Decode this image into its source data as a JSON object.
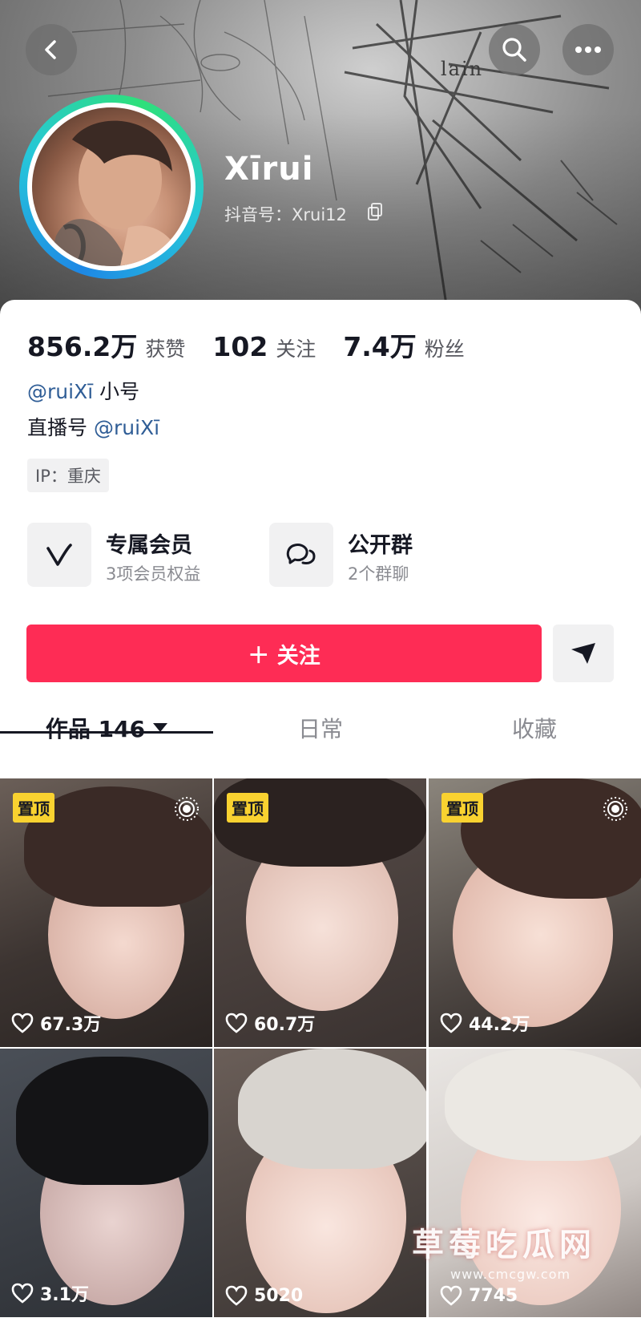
{
  "header": {
    "banner_word": "lain",
    "icons": {
      "back": "chevron-left-icon",
      "search": "search-icon",
      "more": "more-horizontal-icon"
    }
  },
  "profile": {
    "name": "Xīrui",
    "id_text": "抖音号：Xrui12",
    "copy_icon": "copy-icon",
    "ring_colors": [
      "#1e88e5",
      "#26c6da",
      "#2ee07a"
    ]
  },
  "stats": [
    {
      "value": "856.2万",
      "label": "获赞"
    },
    {
      "value": "102",
      "label": "关注"
    },
    {
      "value": "7.4万",
      "label": "粉丝"
    }
  ],
  "bio": {
    "line1_mention": "@ruiXī",
    "line1_text": " 小号",
    "line2_text": "直播号 ",
    "line2_mention": "@ruiXī"
  },
  "ip_tag": "IP：重庆",
  "features": [
    {
      "title": "专属会员",
      "sub": "3项会员权益",
      "icon": "v-badge-icon"
    },
    {
      "title": "公开群",
      "sub": "2个群聊",
      "icon": "group-chat-icon"
    }
  ],
  "actions": {
    "follow_label": "＋ 关注",
    "follow_color": "#fe2c55",
    "share_icon": "share-arrow-icon"
  },
  "tabs": [
    {
      "label": "作品 146",
      "active": true
    },
    {
      "label": "日常",
      "active": false
    },
    {
      "label": "收藏",
      "active": false
    }
  ],
  "videos": [
    {
      "pinned": true,
      "pin_label": "置顶",
      "live": true,
      "likes": "67.3万"
    },
    {
      "pinned": true,
      "pin_label": "置顶",
      "live": false,
      "likes": "60.7万"
    },
    {
      "pinned": true,
      "pin_label": "置顶",
      "live": true,
      "likes": "44.2万"
    },
    {
      "pinned": false,
      "likes": "3.1万"
    },
    {
      "pinned": false,
      "likes": "5020"
    },
    {
      "pinned": false,
      "likes": "7745"
    }
  ],
  "watermark": {
    "title": "草莓吃瓜网",
    "url": "www.cmcgw.com"
  }
}
